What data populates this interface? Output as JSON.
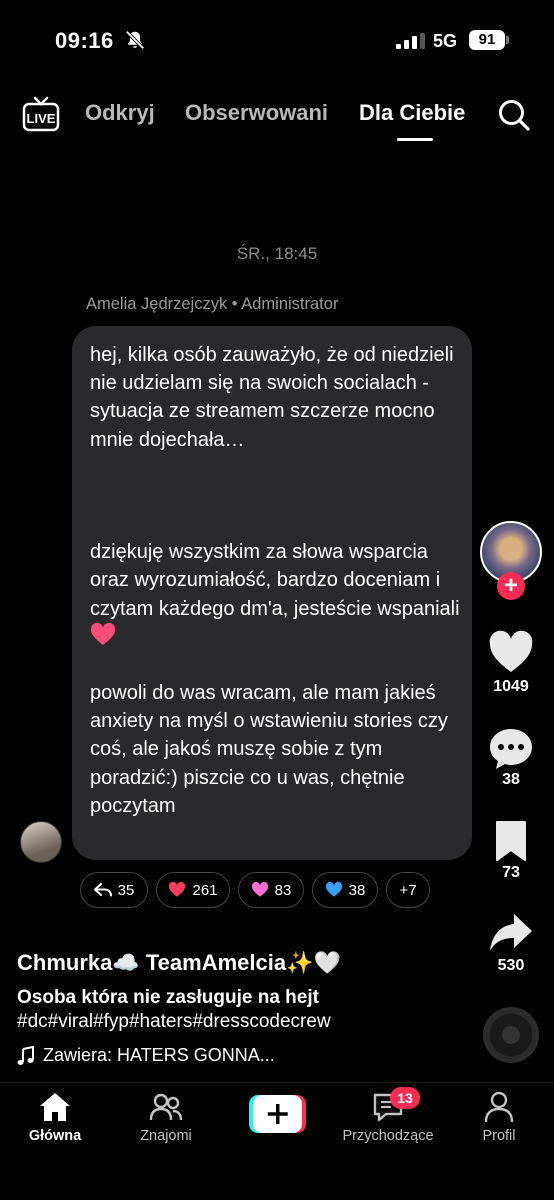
{
  "status_bar": {
    "time": "09:16",
    "network": "5G",
    "battery": "91"
  },
  "top_nav": {
    "live": "LIVE",
    "tabs": [
      "Odkryj",
      "Obserwowani",
      "Dla Ciebie"
    ]
  },
  "chat": {
    "timestamp": "ŚR., 18:45",
    "sender": "Amelia Jędrzejczyk • Administrator",
    "paragraph_1": "hej, kilka osób zauważyło, że od niedzieli nie udzielam się na swoich socialach - sytuacja ze streamem szczerze mocno mnie dojechała…",
    "paragraph_2": "dziękuję wszystkim za słowa wsparcia oraz wyrozumiałość, bardzo doceniam i czytam każdego dm'a, jesteście wspaniali",
    "paragraph_3": "powoli do was wracam, ale mam jakieś anxiety na myśl o wstawieniu stories czy coś, ale jakoś muszę sobie z tym poradzić:) piszcie co u was, chętnie poczytam",
    "reactions": [
      {
        "icon": "reply-icon",
        "count": "35"
      },
      {
        "icon": "red-heart-icon",
        "count": "261",
        "color": "#ff3b5c"
      },
      {
        "icon": "pink-heart-icon",
        "count": "83",
        "color": "#ff6fd8"
      },
      {
        "icon": "blue-heart-icon",
        "count": "38",
        "color": "#3aa0ff"
      },
      {
        "icon": "more-reactions",
        "count": "+7"
      }
    ]
  },
  "actions": {
    "likes": "1049",
    "comments": "38",
    "saves": "73",
    "shares": "530"
  },
  "caption": {
    "author": "Chmurka☁️ TeamAmelcia✨🤍",
    "title": "Osoba która nie zasługuje na hejt",
    "hashtags": "#dc#viral#fyp#haters#dresscodecrew",
    "music": "Zawiera: HATERS GONNA..."
  },
  "bottom_nav": {
    "home": "Główna",
    "friends": "Znajomi",
    "inbox": "Przychodzące",
    "profile": "Profil",
    "inbox_badge": "13"
  },
  "colors": {
    "accent": "#fe2c55",
    "bubble": "#2a2a2c"
  }
}
